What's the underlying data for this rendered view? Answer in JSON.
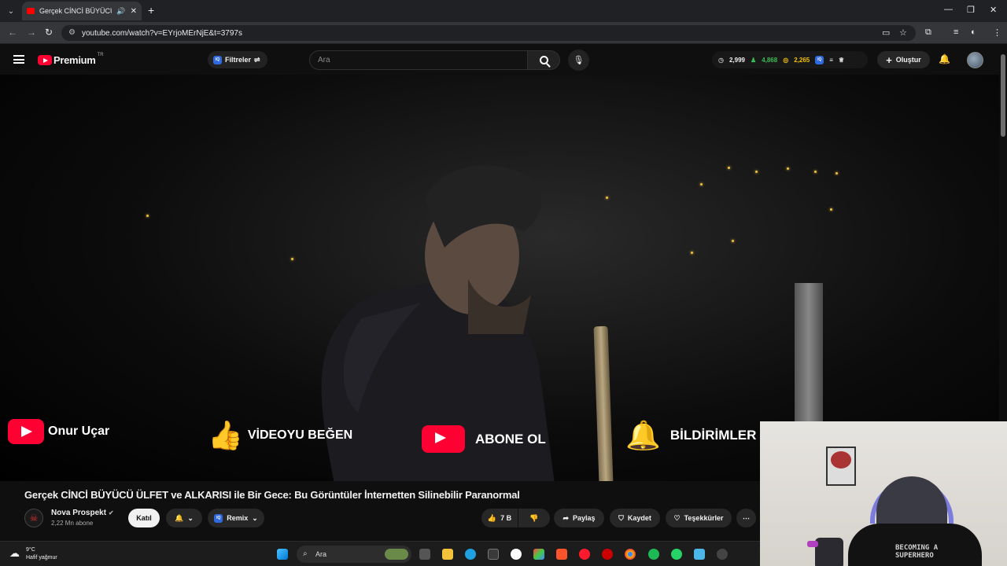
{
  "browser": {
    "tab_title": "Gerçek CİNCİ BÜYÜCÜ ÜLFET",
    "url": "youtube.com/watch?v=EYrjoMErNjE&t=3797s"
  },
  "youtube": {
    "logo_text": "Premium",
    "logo_region": "TR",
    "filters_label": "Filtreler",
    "search_placeholder": "Ara",
    "stats": {
      "a": "2,999",
      "b": "4,868",
      "c": "2,265"
    },
    "create_label": "Oluştur",
    "accent": "#ff0033"
  },
  "video_overlay": {
    "channel_name": "Onur Uçar",
    "like_text": "VİDEOYU BEĞEN",
    "subscribe_text": "ABONE OL",
    "notify_text": "BİLDİRİMLER"
  },
  "video": {
    "title": "Gerçek CİNCİ BÜYÜCÜ ÜLFET ve ALKARISI ile Bir Gece: Bu Görüntüler İnternetten Silinebilir Paranormal",
    "channel": "Nova Prospekt",
    "subscribers": "2,22 Mn abone",
    "join_label": "Katıl",
    "remix_label": "Remix",
    "likes": "7 B",
    "share_label": "Paylaş",
    "save_label": "Kaydet",
    "thanks_label": "Teşekkürler"
  },
  "webcam": {
    "shirt_text": "BECOMING A\nSUPERHERO"
  },
  "taskbar": {
    "weather_temp": "9°C",
    "weather_desc": "Hafif yağmur",
    "search_label": "Ara"
  }
}
